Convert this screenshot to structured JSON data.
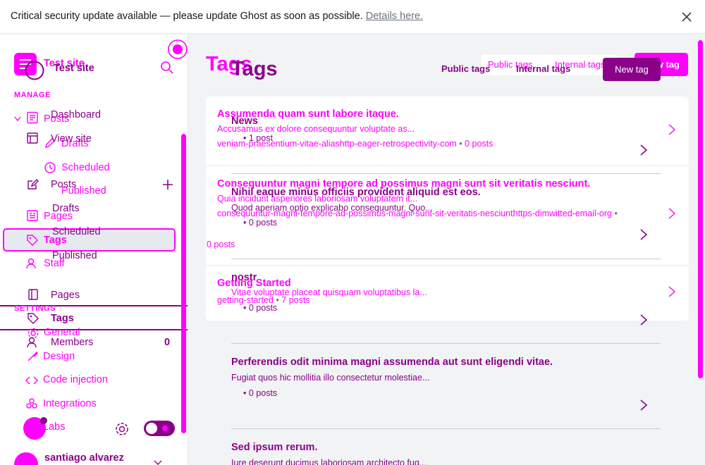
{
  "banner": {
    "message": "Critical security update available — please update Ghost as soon as possible.",
    "link": "Details here."
  },
  "site": {
    "title": "Test site",
    "title_ghost": "Test site"
  },
  "sidebar": {
    "manage_title": "MANAGE",
    "settings_title": "SETTINGS",
    "nav": {
      "dashboard": "Dashboard",
      "view_site": "View site",
      "posts": "Posts",
      "drafts": "Drafts",
      "scheduled": "Scheduled",
      "published": "Published",
      "pages": "Pages",
      "tags": "Tags",
      "members": "Members",
      "members_count": "0"
    },
    "ghost": {
      "posts": "Posts",
      "drafts": "Drafts",
      "scheduled": "Scheduled",
      "published": "Published",
      "pages": "Pages",
      "tags": "Tags",
      "staff": "Staff",
      "general": "General",
      "design": "Design",
      "code_injection": "Code injection",
      "integrations": "Integrations",
      "labs": "Labs"
    },
    "user": {
      "name": "santiago alvarez"
    }
  },
  "main": {
    "title": "Tags",
    "title_ghost": "Tags",
    "tabs": {
      "public": "Public tags",
      "internal": "Internal tags"
    },
    "tabs_ghost": {
      "public": "Public tags",
      "internal": "Internal tags"
    },
    "new_tag": "New tag",
    "new_tag_ghost": "New tag",
    "card_tags": [
      {
        "name": "Assumenda quam sunt labore itaque.",
        "description": "Accusamus ex dolore consequuntur voluptate as...",
        "slug": "veniam-praesentium-vitae-alias",
        "url": "http-eager-retrospectivity-com",
        "count": "0 posts"
      },
      {
        "name": "Consequuntur magni tempore ad possimus magni sunt sit veritatis nesciunt.",
        "description": "Quia incidunt asperiores laboriosam voluptatem it...",
        "slug": "consequuntur-magni-tempore-ad-possimus-magni-sunt-sit-veritatis-nesciunt",
        "url": "https-dimwitted-email-org",
        "count": "0 posts"
      },
      {
        "name": "Getting Started",
        "description": "Vitae voluptate placeat quisquam voluptatibus la...",
        "slug": "getting-started",
        "count": "7 posts"
      }
    ],
    "list_tags": [
      {
        "name": "News",
        "count": "1 post"
      },
      {
        "name": "Nihil eaque minus officiis provident aliquid est eos.",
        "description": "Quod aperiam optio explicabo consequuntur. Quo...",
        "count": "0 posts"
      },
      {
        "name": "nostr",
        "count": "0 posts"
      },
      {
        "name": "Perferendis odit minima magni assumenda aut sunt eligendi vitae.",
        "description": "Fugiat quos hic mollitia illo consectetur molestiae...",
        "count": "0 posts"
      },
      {
        "name": "Sed ipsum rerum.",
        "description": "Iure deserunt ducimus laboriosam architecto fug..."
      }
    ],
    "stray_count": "0 posts"
  },
  "colors": {
    "accent": "#ff00ff",
    "accent_dark": "#8b0089",
    "bg": "#f1f3f4"
  }
}
